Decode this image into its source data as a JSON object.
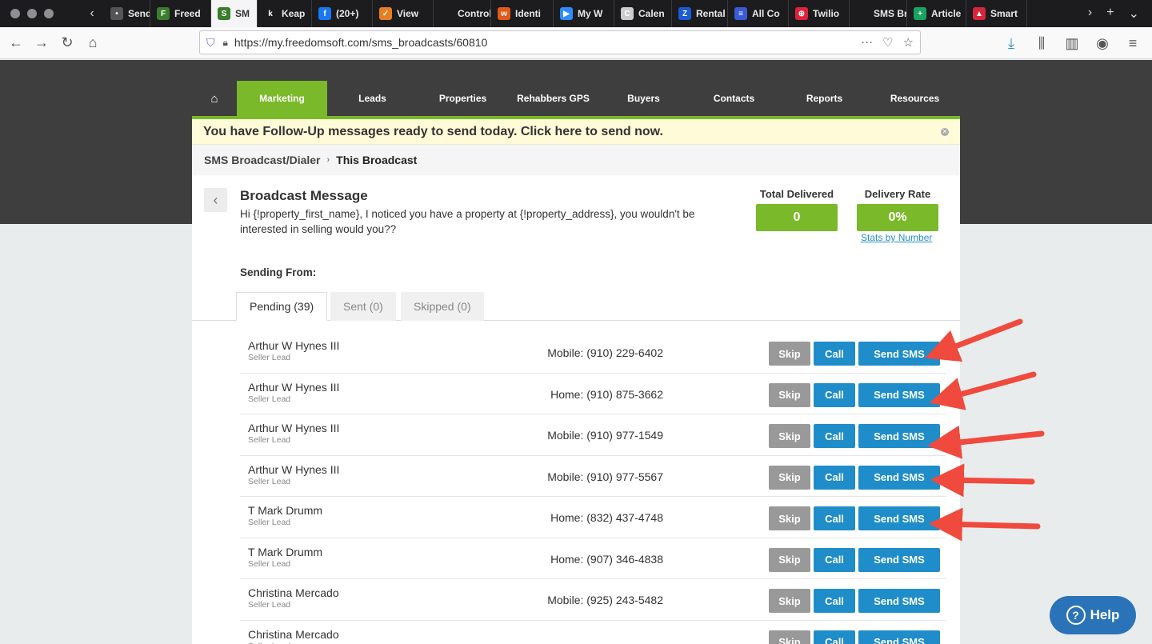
{
  "browser": {
    "tabs": [
      {
        "label": "Sende",
        "color": "#555555",
        "glyph": "•"
      },
      {
        "label": "Freed",
        "color": "#3a7d2b",
        "glyph": "F"
      },
      {
        "label": "SM",
        "color": "#3a7d2b",
        "glyph": "S",
        "active": true
      },
      {
        "label": "Keap",
        "color": "#1c1c1e",
        "glyph": "k"
      },
      {
        "label": "(20+)",
        "color": "#1877f2",
        "glyph": "f"
      },
      {
        "label": "View",
        "color": "#e67e22",
        "glyph": "✓"
      },
      {
        "label": "Control Pa",
        "color": "#1c1c1e",
        "glyph": ""
      },
      {
        "label": "Identi",
        "color": "#e05a1a",
        "glyph": "w"
      },
      {
        "label": "My W",
        "color": "#2d8cff",
        "glyph": "▶"
      },
      {
        "label": "Calen",
        "color": "#cccccc",
        "glyph": "C"
      },
      {
        "label": "Rental",
        "color": "#1a5bd6",
        "glyph": "Z"
      },
      {
        "label": "All Co",
        "color": "#3a5bd6",
        "glyph": "≡"
      },
      {
        "label": "Twilio",
        "color": "#e0223b",
        "glyph": "⊕"
      },
      {
        "label": "SMS Broa",
        "color": "#1c1c1e",
        "glyph": ""
      },
      {
        "label": "Article",
        "color": "#1aa260",
        "glyph": "+"
      },
      {
        "label": "Smart",
        "color": "#d6263b",
        "glyph": "▲"
      }
    ],
    "url": "https://my.freedomsoft.com/sms_broadcasts/60810"
  },
  "nav": {
    "items": [
      "Marketing",
      "Leads",
      "Properties",
      "Rehabbers GPS",
      "Buyers",
      "Contacts",
      "Reports",
      "Resources"
    ]
  },
  "alert": {
    "text": "You have Follow-Up messages ready to send today. Click here to send now."
  },
  "breadcrumb": {
    "parent": "SMS Broadcast/Dialer",
    "current": "This Broadcast"
  },
  "broadcast": {
    "title": "Broadcast Message",
    "body": "Hi {!property_first_name}, I noticed you have a property at {!property_address}, you wouldn't be interested in selling would you??",
    "total_delivered_label": "Total Delivered",
    "total_delivered_value": "0",
    "delivery_rate_label": "Delivery Rate",
    "delivery_rate_value": "0%",
    "stats_link": "Stats by Number",
    "sending_from_label": "Sending From:"
  },
  "tabs": {
    "pending": "Pending (39)",
    "sent": "Sent (0)",
    "skipped": "Skipped (0)"
  },
  "buttons": {
    "skip": "Skip",
    "call": "Call",
    "sms": "Send SMS"
  },
  "rows": [
    {
      "name": "Arthur W Hynes III",
      "type": "Seller Lead",
      "phone": "Mobile: (910) 229-6402"
    },
    {
      "name": "Arthur W Hynes III",
      "type": "Seller Lead",
      "phone": "Home: (910) 875-3662"
    },
    {
      "name": "Arthur W Hynes III",
      "type": "Seller Lead",
      "phone": "Mobile: (910) 977-1549"
    },
    {
      "name": "Arthur W Hynes III",
      "type": "Seller Lead",
      "phone": "Mobile: (910) 977-5567"
    },
    {
      "name": "T Mark Drumm",
      "type": "Seller Lead",
      "phone": "Home: (832) 437-4748"
    },
    {
      "name": "T Mark Drumm",
      "type": "Seller Lead",
      "phone": "Home: (907) 346-4838"
    },
    {
      "name": "Christina Mercado",
      "type": "Seller Lead",
      "phone": "Mobile: (925) 243-5482"
    },
    {
      "name": "Christina Mercado",
      "type": "Seller Lead",
      "phone": ""
    }
  ],
  "help": {
    "label": "Help"
  },
  "colors": {
    "accent_green": "#7ab929",
    "button_blue": "#1f8dc9",
    "arrow_red": "#f04a3e"
  }
}
